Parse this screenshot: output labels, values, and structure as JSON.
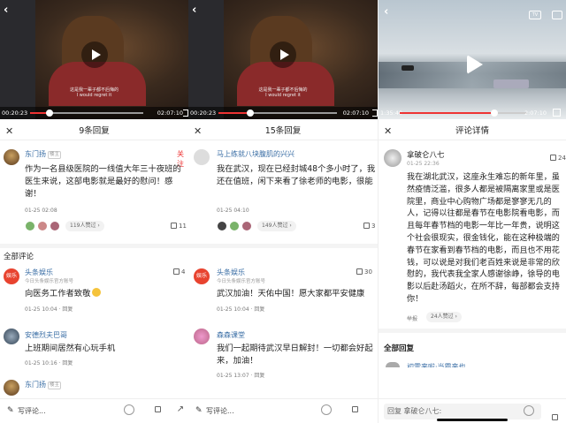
{
  "panel1": {
    "video": {
      "subtitle_cn": "这是我一辈子都不后悔的",
      "subtitle_en": "I would regret it",
      "time_current": "00:20:23",
      "time_total": "02:07:10",
      "progress": 0.17
    },
    "header_title": "9条回复",
    "featured": {
      "user": "东门扬",
      "badge": "楼主",
      "follow": "关注",
      "text": "作为一名县级医院的一线值大年三十夜班的医生来说，这部电影就是最好的慰问！感谢！",
      "time": "01-25 02:08",
      "likers": "119人赞过",
      "likes": "11"
    },
    "section": "全部评论",
    "comments": [
      {
        "user": "头条娱乐",
        "src": "今日头条娱乐官方账号",
        "text": "向医务工作者致敬",
        "time": "01-25 10:04 · 回复",
        "likes": "4",
        "avatar_text": "娱乐"
      },
      {
        "user": "安德烈夫巴哥",
        "src": "",
        "text": "上班期间居然有心玩手机",
        "time": "01-25 10:16 · 回复",
        "likes": "",
        "avatar_text": ""
      },
      {
        "user": "东门扬",
        "badge": "楼主",
        "src": "",
        "text": "",
        "time": "",
        "likes": "",
        "avatar_text": ""
      }
    ],
    "compose_placeholder": "写评论..."
  },
  "panel2": {
    "video": {
      "subtitle_cn": "这是我一辈子都不后悔的",
      "subtitle_en": "I would regret it",
      "time_current": "00:20:23",
      "time_total": "02:07:10",
      "progress": 0.27
    },
    "header_title": "15条回复",
    "featured": {
      "user": "马上练就八块腹肌的兴兴",
      "text": "我在武汉，现在已经封城48个多小时了，我还在值班，闲下来看了徐老师的电影，很能",
      "time": "01-25 04:10",
      "likers": "149人赞过",
      "likes": "3"
    },
    "comments": [
      {
        "user": "头条娱乐",
        "src": "今日头条娱乐官方账号",
        "text": "武汉加油！天佑中国！愿大家都平安健康",
        "time": "01-25 10:04 · 回复",
        "likes": "30",
        "avatar_text": "娱乐"
      },
      {
        "user": "森森课堂",
        "src": "",
        "text": "我们一起期待武汉早日解封！一切都会好起来，加油！",
        "time": "01-25 13:07 · 回复",
        "likes": "",
        "avatar_text": ""
      }
    ],
    "compose_placeholder": "写评论..."
  },
  "panel3": {
    "video": {
      "time_current": "1:35:40",
      "time_total": "2:07:10",
      "progress": 0.74
    },
    "header_title": "评论详情",
    "author": {
      "user": "拿破仑八七",
      "time": "01-25 22:36",
      "likes": "24",
      "text": "我在湖北武汉，这座永生难忘的新年里，虽然疫情泛滥，很多人都是被隔离家里或是医院里，商业中心购物广场都是寥寥无几的人，记得以往都是春节在电影院看电影，而且每年春节档的电影一年比一年贵，说明这个社会很现实，很金钱化，能在这种极端的春节在家看到春节档的电影，而且也不用花钱，可以说是对我们老百姓来说是非常的欣慰的，我代表我全家人感谢徐峥，徐导的电影以后赴汤蹈火，在所不辞，每部都会支持你！",
      "report": "举报",
      "likers": "24人赞过"
    },
    "section": "全部回复",
    "next_user": "初雪来啦·当霜来也",
    "reply_placeholder": "回复 拿破仑八七:"
  }
}
